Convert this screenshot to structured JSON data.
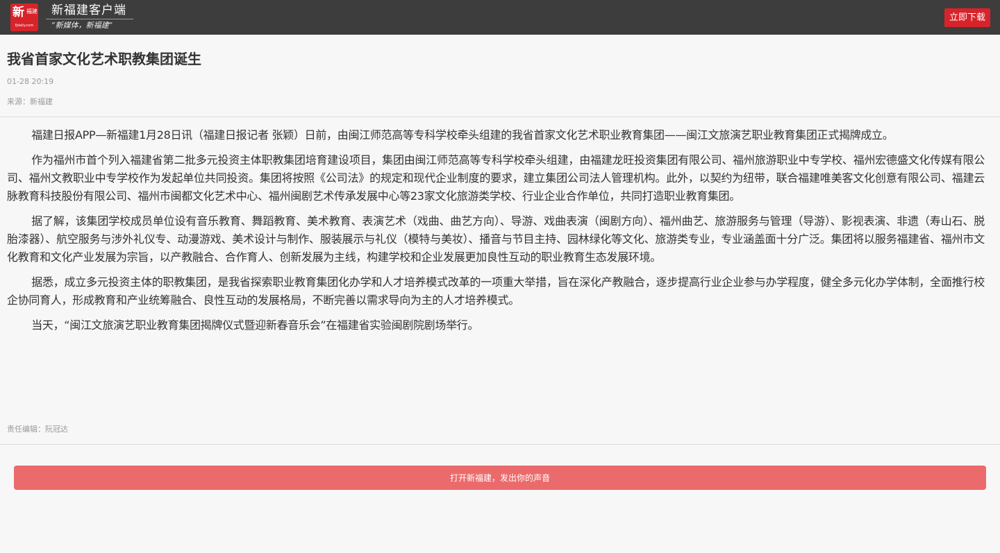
{
  "header": {
    "logo": {
      "char_big": "新",
      "char_small": "福建",
      "domain": "fjdaily.com"
    },
    "app_name": "新福建客户端",
    "slogan": "“新媒体，新福建”",
    "download_label": "立即下载"
  },
  "article": {
    "title": "我省首家文化艺术职教集团诞生",
    "time": "01-28 20:19",
    "source": "来源：新福建",
    "paragraphs": [
      "福建日报APP—新福建1月28日讯（福建日报记者 张颖）日前，由闽江师范高等专科学校牵头组建的我省首家文化艺术职业教育集团——闽江文旅演艺职业教育集团正式揭牌成立。",
      "作为福州市首个列入福建省第二批多元投资主体职教集团培育建设项目，集团由闽江师范高等专科学校牵头组建，由福建龙旺投资集团有限公司、福州旅游职业中专学校、福州宏德盛文化传媒有限公司、福州文教职业中专学校作为发起单位共同投资。集团将按照《公司法》的规定和现代企业制度的要求，建立集团公司法人管理机构。此外，以契约为纽带，联合福建唯美客文化创意有限公司、福建云脉教育科技股份有限公司、福州市闽都文化艺术中心、福州闽剧艺术传承发展中心等23家文化旅游类学校、行业企业合作单位，共同打造职业教育集团。",
      "据了解，该集团学校成员单位设有音乐教育、舞蹈教育、美术教育、表演艺术（戏曲、曲艺方向）、导游、戏曲表演（闽剧方向）、福州曲艺、旅游服务与管理（导游）、影视表演、非遗（寿山石、脱胎漆器）、航空服务与涉外礼仪专、动漫游戏、美术设计与制作、服装展示与礼仪（模特与美妆）、播音与节目主持、园林绿化等文化、旅游类专业，专业涵盖面十分广泛。集团将以服务福建省、福州市文化教育和文化产业发展为宗旨，以产教融合、合作育人、创新发展为主线，构建学校和企业发展更加良性互动的职业教育生态发展环境。",
      "据悉，成立多元投资主体的职教集团，是我省探索职业教育集团化办学和人才培养模式改革的一项重大举措，旨在深化产教融合，逐步提高行业企业参与办学程度，健全多元化办学体制，全面推行校企协同育人，形成教育和产业统筹融合、良性互动的发展格局，不断完善以需求导向为主的人才培养模式。",
      "当天，“闽江文旅演艺职业教育集团揭牌仪式暨迎新春音乐会”在福建省实验闽剧院剧场举行。"
    ],
    "editor": "责任编辑：阮冠达"
  },
  "footer": {
    "open_app_label": "打开新福建，发出你的声音"
  },
  "colors": {
    "topbar_bg": "#3d3d3d",
    "brand_red": "#d8232a",
    "open_button_bg": "#eb6a6b",
    "page_bg": "#f7f7f7"
  }
}
